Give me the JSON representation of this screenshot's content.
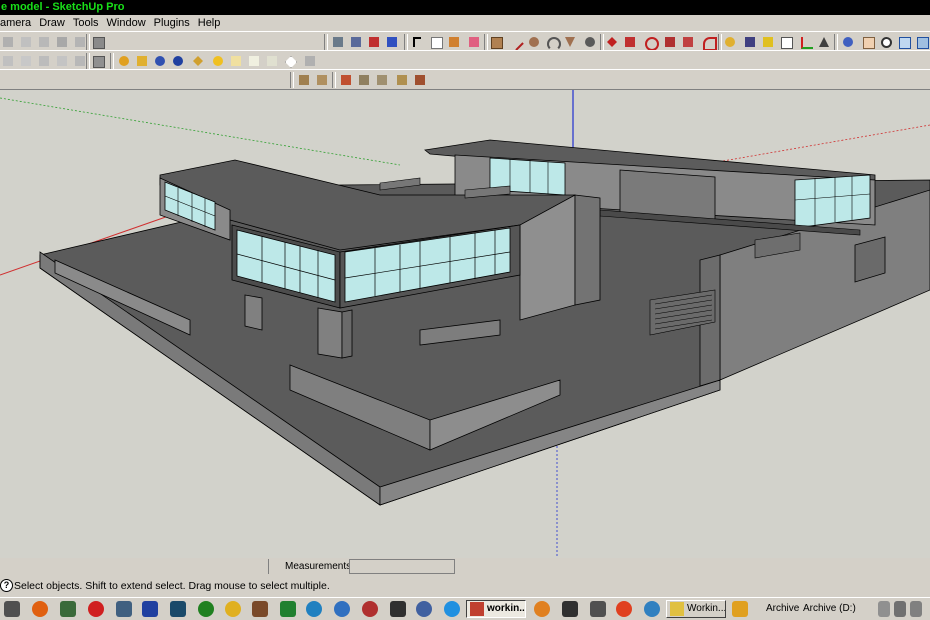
{
  "window": {
    "title": "e model - SketchUp Pro"
  },
  "menubar": {
    "items": [
      "amera",
      "Draw",
      "Tools",
      "Window",
      "Plugins",
      "Help"
    ]
  },
  "toolbar": {
    "row1_tools": [
      "select-tool",
      "component-tool",
      "paint-bucket-tool",
      "eraser-tool",
      "rectangle-tool",
      "line-tool",
      "circle-tool",
      "arc-tool",
      "polygon-tool",
      "freehand-tool",
      "move-tool",
      "push-pull-tool",
      "rotate-tool",
      "follow-me-tool",
      "scale-tool",
      "offset-tool",
      "tape-measure-tool",
      "dimension-tool",
      "protractor-tool",
      "text-tool",
      "axes-tool",
      "3d-text-tool",
      "orbit-tool",
      "pan-tool",
      "zoom-tool",
      "zoom-window-tool",
      "zoom-extents-tool"
    ],
    "row2_tools": [
      "sandbox-from-contours",
      "sandbox-from-scratch",
      "smoove-tool",
      "stamp-tool",
      "drape-tool",
      "add-detail-tool",
      "flip-edge-tool",
      "shadow-tool"
    ],
    "row3_tools": [
      "x-ray-style",
      "back-edges-style",
      "wireframe-style",
      "hidden-line-style",
      "shaded-style",
      "shaded-textures-style",
      "monochrome-style"
    ]
  },
  "status": {
    "measurements_label": "Measurements",
    "measurements_value": "",
    "hint": "Select objects. Shift to extend select. Drag mouse to select multiple."
  },
  "taskbar": {
    "buttons": [
      {
        "label": "workin...",
        "active": true
      },
      {
        "label": "Workin...",
        "active": false
      }
    ],
    "drives": [
      "Archive",
      "Archive (D:)"
    ]
  },
  "colors": {
    "titlebar_bg": "#000000",
    "titlebar_text": "#19e019",
    "viewport_bg": "#d2d2cb",
    "building_dark": "#5b5b5b",
    "glass": "#bde8e8",
    "axis_red": "#d03030",
    "axis_green": "#30a030",
    "axis_blue": "#2030d0"
  }
}
